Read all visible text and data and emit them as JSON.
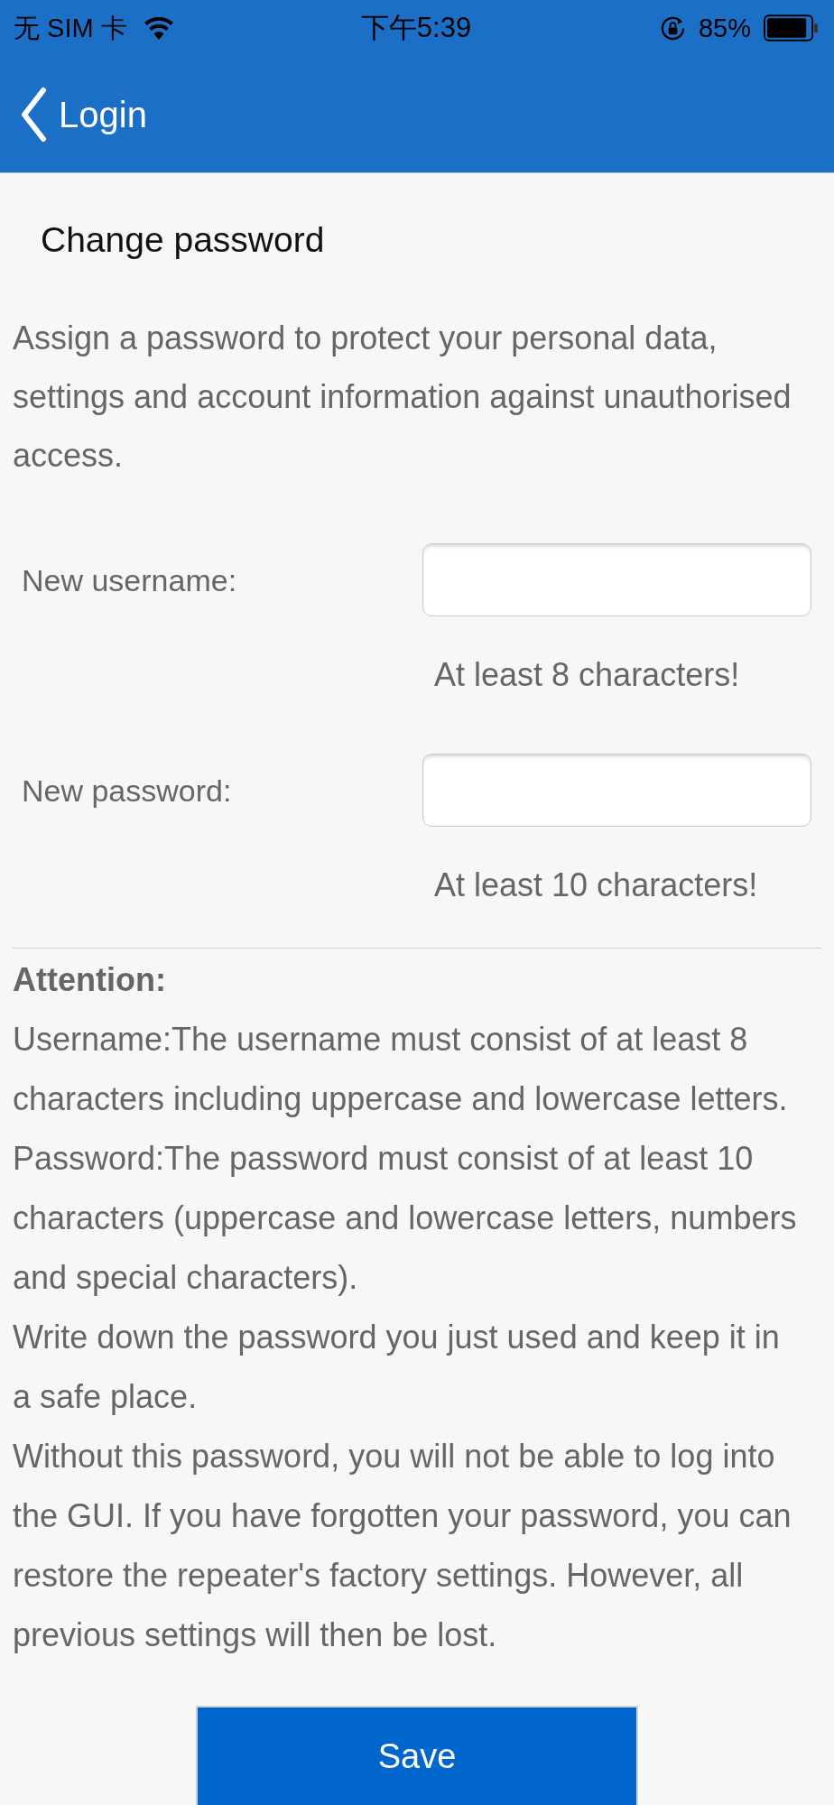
{
  "status_bar": {
    "carrier": "无 SIM 卡",
    "time": "下午5:39",
    "battery": "85%"
  },
  "nav_bar": {
    "back_label": "Login"
  },
  "title": "Change password",
  "intro": "Assign a password to protect your personal data, settings and account information against unauthorised access.",
  "fields": [
    {
      "label": "New username:",
      "hint": "At least 8 characters!"
    },
    {
      "label": "New password:",
      "hint": "At least 10 characters!"
    }
  ],
  "attention": {
    "title": "Attention:",
    "paragraphs": [
      "Username:The username must consist of at least 8 characters including uppercase and lowercase letters.",
      "Password:The password must consist of at least 10 characters (uppercase and lowercase letters, numbers and special characters).",
      "Write down the password you just used and keep it in a safe place.",
      "Without this password, you will not be able to log into the GUI. If you have forgotten your password, you can restore the repeater's factory settings. However, all previous settings will then be lost."
    ]
  },
  "save_button": "Save"
}
